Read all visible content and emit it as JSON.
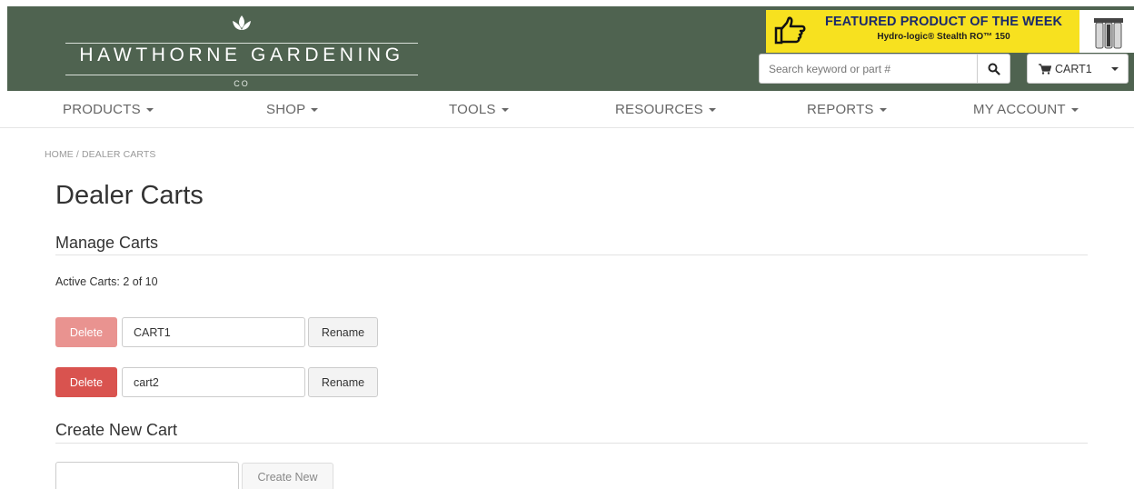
{
  "brand": {
    "name": "HAWTHORNE GARDENING",
    "suffix": "CO"
  },
  "featured": {
    "title": "FEATURED PRODUCT OF THE WEEK",
    "product": "Hydro-logic® Stealth RO™ 150"
  },
  "search": {
    "placeholder": "Search keyword or part #"
  },
  "cart_menu": {
    "label": "CART1"
  },
  "nav": {
    "items": [
      "PRODUCTS",
      "SHOP",
      "TOOLS",
      "RESOURCES",
      "REPORTS",
      "MY ACCOUNT"
    ]
  },
  "breadcrumb": {
    "text": "HOME /  DEALER CARTS"
  },
  "page": {
    "title": "Dealer Carts",
    "manage_title": "Manage Carts",
    "active_carts": "Active Carts: 2 of 10",
    "create_title": "Create New Cart"
  },
  "carts": [
    {
      "delete_label": "Delete",
      "name": "CART1",
      "rename_label": "Rename"
    },
    {
      "delete_label": "Delete",
      "name": "cart2",
      "rename_label": "Rename"
    }
  ],
  "create": {
    "value": "",
    "button_label": "Create New"
  },
  "colors": {
    "header_bg": "#4f6350",
    "featured_yellow": "#f7e11f",
    "delete_active": "#d9534f",
    "delete_disabled": "#e99390"
  }
}
